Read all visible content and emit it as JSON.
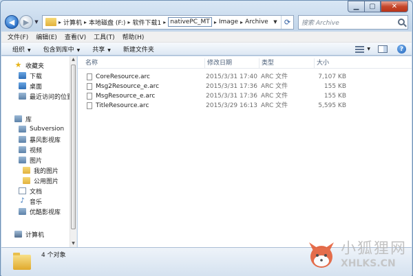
{
  "address": {
    "crumbs": [
      "计算机",
      "本地磁盘 (F:)",
      "软件下载1",
      "nativePC_MT",
      "Image",
      "Archive"
    ],
    "separator": "▸"
  },
  "search": {
    "placeholder": "搜索 Archive"
  },
  "menu": [
    "文件(F)",
    "编辑(E)",
    "查看(V)",
    "工具(T)",
    "帮助(H)"
  ],
  "commands": {
    "organize": "组织",
    "include_library": "包含到库中",
    "share": "共享",
    "new_folder": "新建文件夹"
  },
  "nav": {
    "favorites": "收藏夹",
    "downloads": "下载",
    "desktop": "桌面",
    "recent": "最近访问的位置",
    "libraries": "库",
    "subversion": "Subversion",
    "baofeng": "暴风影视库",
    "videos": "视频",
    "pictures": "图片",
    "my_pictures": "我的图片",
    "public_pictures": "公用图片",
    "documents": "文档",
    "music": "音乐",
    "youku": "优酷影视库",
    "computer": "计算机"
  },
  "columns": {
    "name": "名称",
    "modified": "修改日期",
    "type": "类型",
    "size": "大小"
  },
  "files": [
    {
      "name": "CoreResource.arc",
      "modified": "2015/3/31 17:40",
      "type": "ARC 文件",
      "size": "7,107 KB"
    },
    {
      "name": "Msg2Resource_e.arc",
      "modified": "2015/3/31 17:36",
      "type": "ARC 文件",
      "size": "155 KB"
    },
    {
      "name": "MsgResource_e.arc",
      "modified": "2015/3/31 17:36",
      "type": "ARC 文件",
      "size": "155 KB"
    },
    {
      "name": "TitleResource.arc",
      "modified": "2015/3/29 16:13",
      "type": "ARC 文件",
      "size": "5,595 KB"
    }
  ],
  "status": {
    "count": "4 个对象"
  },
  "watermark": {
    "cn": "小狐狸网",
    "en": "XHLKS.CN"
  }
}
